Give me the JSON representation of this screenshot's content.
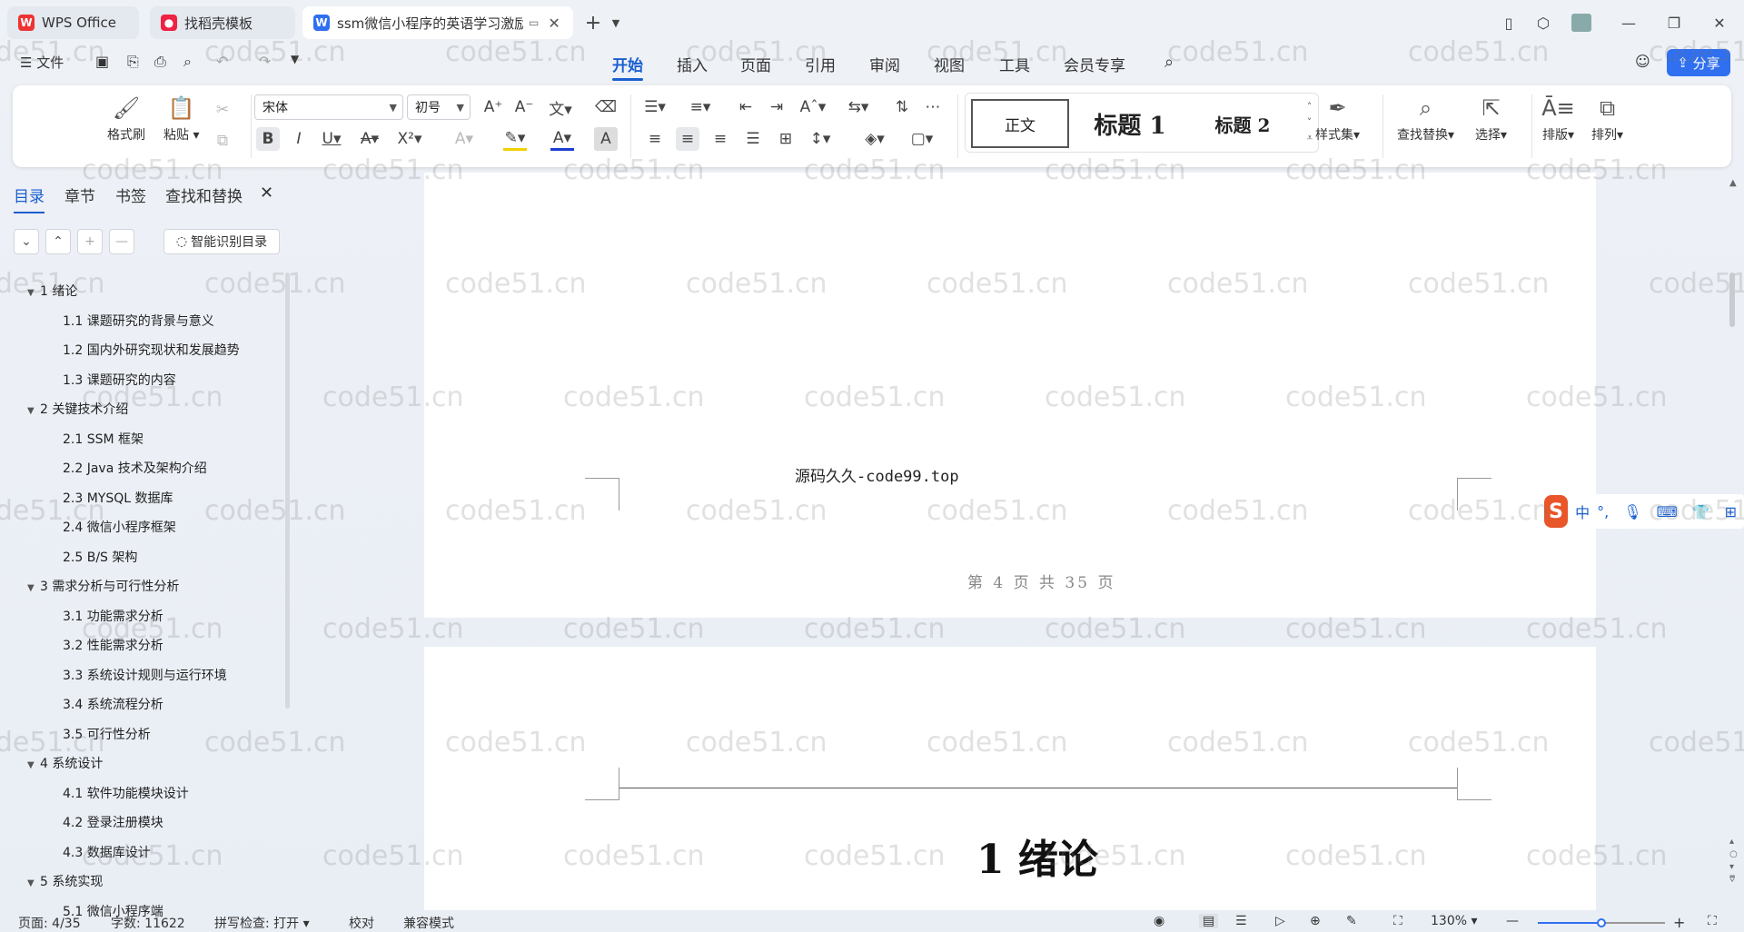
{
  "tabs": [
    {
      "label": "WPS Office",
      "icon": "wps-logo-icon"
    },
    {
      "label": "找稻壳模板",
      "icon": "docer-icon"
    },
    {
      "label": "ssm微信小程序的英语学习激励",
      "icon": "word-doc-icon"
    }
  ],
  "menu": {
    "file": "文件",
    "items": [
      "开始",
      "插入",
      "页面",
      "引用",
      "审阅",
      "视图",
      "工具",
      "会员专享"
    ],
    "active": "开始",
    "share": "分享"
  },
  "toolbar": {
    "format_painter": "格式刷",
    "paste": "粘贴",
    "font_name": "宋体",
    "font_size": "初号",
    "styles": [
      "正文",
      "标题 1",
      "标题 2"
    ],
    "style_set": "样式集",
    "find_replace": "查找替换",
    "select": "选择",
    "layout": "排版",
    "arrange": "排列"
  },
  "panel": {
    "tabs": [
      "目录",
      "章节",
      "书签",
      "查找和替换"
    ],
    "smart_toc": "智能识别目录"
  },
  "toc": [
    {
      "label": "1 绪论",
      "level": 1
    },
    {
      "label": "1.1  课题研究的背景与意义",
      "level": 2
    },
    {
      "label": "1.2  国内外研究现状和发展趋势",
      "level": 2
    },
    {
      "label": "1.3  课题研究的内容",
      "level": 2
    },
    {
      "label": "2  关键技术介绍",
      "level": 1
    },
    {
      "label": "2.1 SSM 框架",
      "level": 2
    },
    {
      "label": "2.2 Java 技术及架构介绍",
      "level": 2
    },
    {
      "label": "2.3 MYSQL 数据库",
      "level": 2
    },
    {
      "label": "2.4 微信小程序框架",
      "level": 2
    },
    {
      "label": "2.5 B/S 架构",
      "level": 2
    },
    {
      "label": "3  需求分析与可行性分析",
      "level": 1
    },
    {
      "label": "3.1 功能需求分析",
      "level": 2
    },
    {
      "label": "3.2  性能需求分析",
      "level": 2
    },
    {
      "label": "3.3 系统设计规则与运行环境",
      "level": 2
    },
    {
      "label": "3.4 系统流程分析",
      "level": 2
    },
    {
      "label": "3.5  可行性分析",
      "level": 2
    },
    {
      "label": "4  系统设计",
      "level": 1
    },
    {
      "label": "4.1 软件功能模块设计",
      "level": 2
    },
    {
      "label": "4.2 登录注册模块",
      "level": 2
    },
    {
      "label": "4.3 数据库设计",
      "level": 2
    },
    {
      "label": "5 系统实现",
      "level": 1
    },
    {
      "label": "5.1 微信小程序端",
      "level": 2
    }
  ],
  "document": {
    "footer_text": "源码久久-code99.top",
    "page_footer": "第 4 页 共 35 页",
    "chapter_title": "1 绪论"
  },
  "ime": {
    "lang": "中",
    "punct": "°,"
  },
  "status": {
    "page": "页面: 4/35",
    "words": "字数: 11622",
    "spell": "拼写检查: 打开",
    "proof": "校对",
    "compat": "兼容模式",
    "zoom": "130%",
    "zoom_level": 0.5
  },
  "watermark": "code51.cn"
}
